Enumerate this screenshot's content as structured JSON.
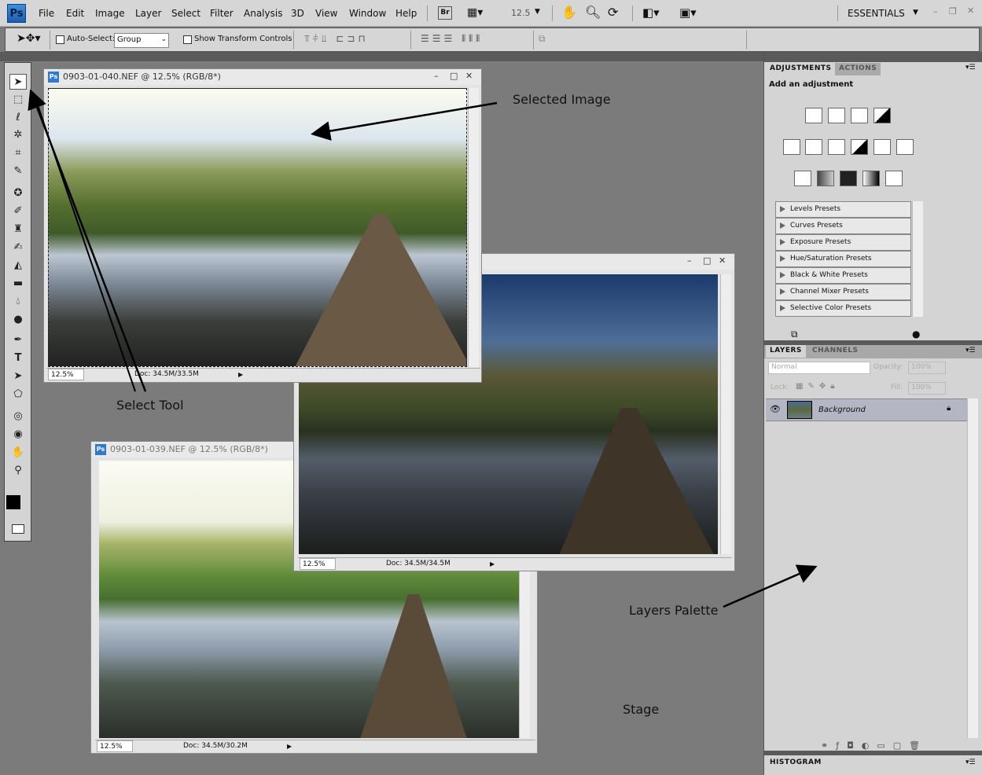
{
  "app": {
    "logo": "Ps"
  },
  "menu": [
    "File",
    "Edit",
    "Image",
    "Layer",
    "Select",
    "Filter",
    "Analysis",
    "3D",
    "View",
    "Window",
    "Help"
  ],
  "appbar": {
    "bridge": "Br",
    "zoom": "12.5",
    "workspace": "ESSENTIALS"
  },
  "options": {
    "auto_select_label": "Auto-Select:",
    "auto_select_value": "Group",
    "transform_label": "Show Transform Controls"
  },
  "documents": [
    {
      "title": "0903-01-040.NEF @ 12.5% (RGB/8*)",
      "zoom": "12.5%",
      "doc": "Doc: 34.5M/33.5M"
    },
    {
      "title": "",
      "zoom": "12.5%",
      "doc": "Doc: 34.5M/34.5M"
    },
    {
      "title": "0903-01-039.NEF @ 12.5% (RGB/8*)",
      "zoom": "12.5%",
      "doc": "Doc: 34.5M/30.2M"
    }
  ],
  "annotations": {
    "selected_image": "Selected Image",
    "select_tool": "Select Tool",
    "layers_palette": "Layers Palette",
    "stage": "Stage"
  },
  "adjustments": {
    "tabs": [
      "ADJUSTMENTS",
      "ACTIONS"
    ],
    "heading": "Add an adjustment",
    "presets": [
      "Levels Presets",
      "Curves Presets",
      "Exposure Presets",
      "Hue/Saturation Presets",
      "Black & White Presets",
      "Channel Mixer Presets",
      "Selective Color Presets"
    ]
  },
  "layers": {
    "tabs": [
      "LAYERS",
      "CHANNELS"
    ],
    "blend": "Normal",
    "opacity_label": "Opacity:",
    "opacity": "100%",
    "lock_label": "Lock:",
    "fill_label": "Fill:",
    "fill": "100%",
    "items": [
      {
        "name": "Background"
      }
    ]
  },
  "histogram": {
    "tab": "HISTOGRAM"
  }
}
